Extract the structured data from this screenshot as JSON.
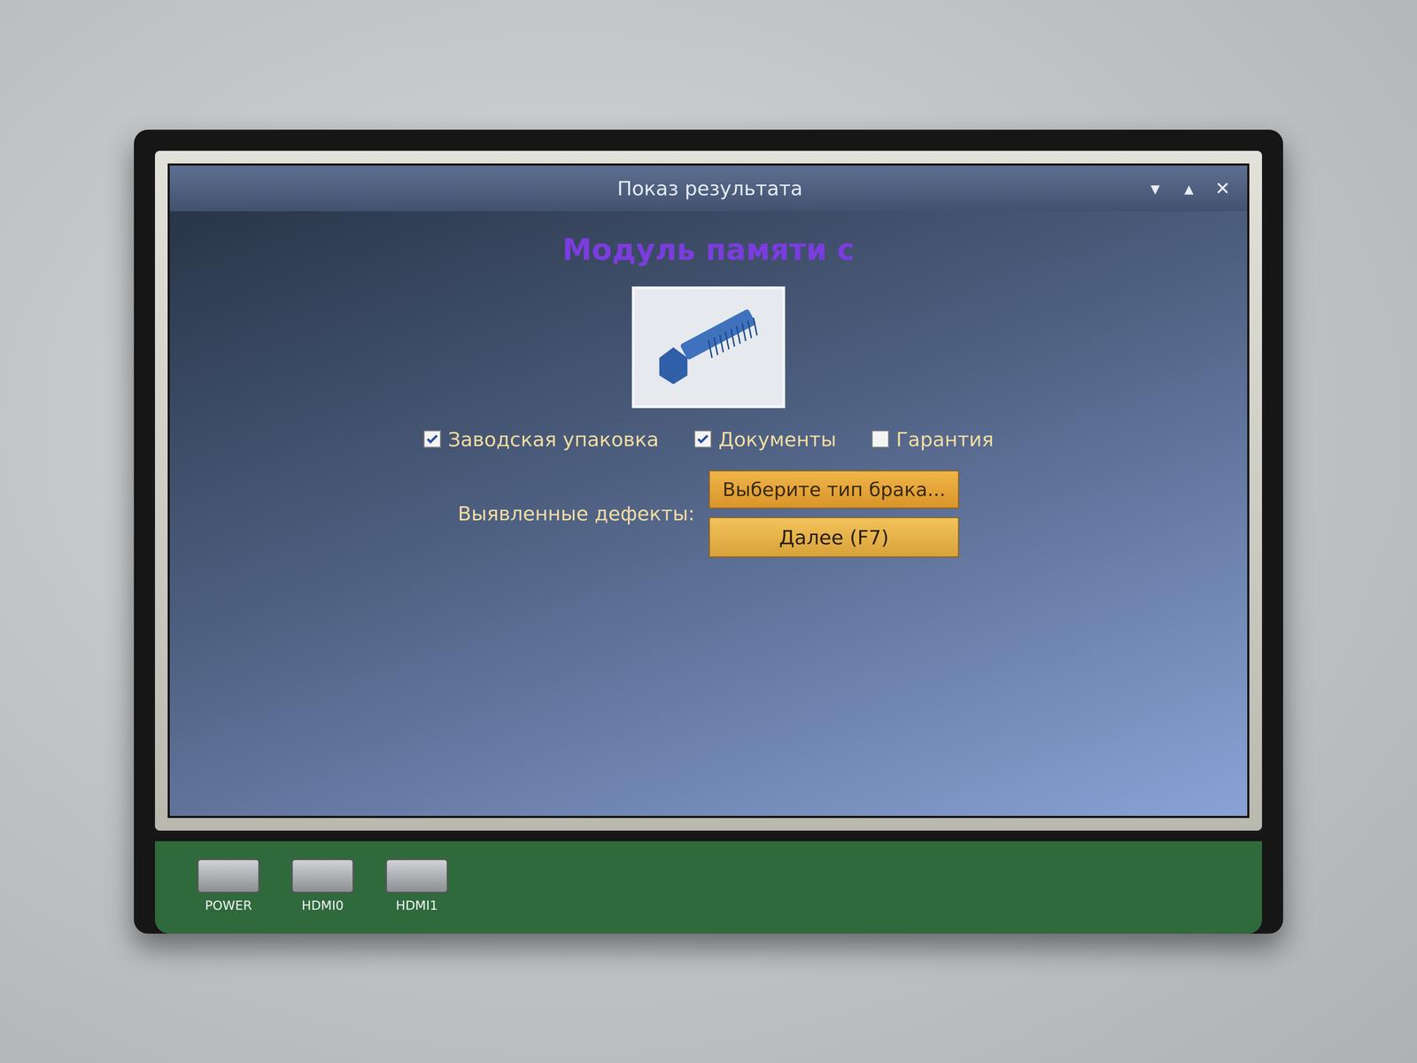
{
  "window": {
    "title": "Показ результата",
    "controls": [
      "▾",
      "▴",
      "✕"
    ]
  },
  "heading": "Модуль памяти с",
  "options": [
    {
      "label": "Заводская упаковка",
      "checked": true
    },
    {
      "label": "Документы",
      "checked": true
    },
    {
      "label": "Гарантия",
      "checked": false
    }
  ],
  "defects": {
    "label": "Выявленные дефекты:",
    "placeholder": "Выберите тип брака..."
  },
  "buttons": [
    "Далее (F7)"
  ],
  "board": {
    "ports": [
      "POWER",
      "HDMI0",
      "HDMI1"
    ]
  }
}
